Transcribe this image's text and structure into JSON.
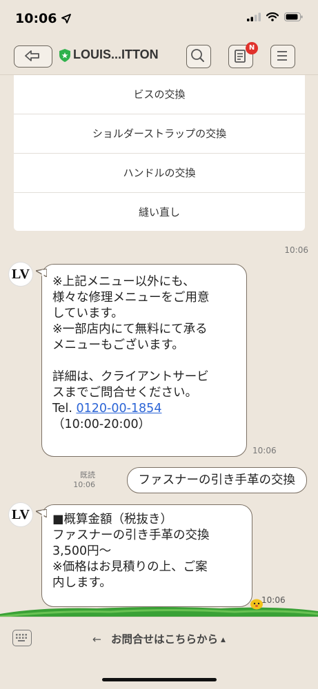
{
  "status": {
    "time": "10:06"
  },
  "nav": {
    "title": "LOUIS...ITTON",
    "badge": "N"
  },
  "menu": {
    "items": [
      "ビスの交換",
      "ショルダーストラップの交換",
      "ハンドルの交換",
      "縫い直し"
    ],
    "time": "10:06"
  },
  "avatar": {
    "text": "LV"
  },
  "messages": {
    "m1": {
      "lines": [
        "※上記メニュー以外にも、",
        "様々な修理メニューをご用意",
        "しています。",
        "※一部店内にて無料にて承る",
        "メニューもございます。",
        "",
        "詳細は、クライアントサービ",
        "スまでご問合せください。"
      ],
      "tel_prefix": "Tel. ",
      "tel": "0120-00-1854",
      "hours": "（10:00-20:00）",
      "time": "10:06"
    },
    "sent": {
      "read": "既読",
      "time": "10:06",
      "text": "ファスナーの引き手革の交換"
    },
    "m2": {
      "lines": [
        "■概算金額（税抜き）",
        "ファスナーの引き手革の交換",
        "3,500円～",
        "※価格はお見積りの上、ご案",
        "内します。"
      ],
      "time": "10:06"
    }
  },
  "bottom": {
    "richmenu_label": "お問合せはこちらから",
    "arrow_left": "←",
    "arrow_up": "▲"
  },
  "colors": {
    "background": "#ede6dc",
    "link": "#2b64d6",
    "badge": "#e0312b",
    "shield": "#2fb24c",
    "grass": "#3aa136"
  },
  "icons": [
    "location-arrow-icon",
    "signal-icon",
    "wifi-icon",
    "battery-icon",
    "back-arrow-icon",
    "shield-icon",
    "search-icon",
    "notes-icon",
    "menu-icon",
    "keyboard-icon",
    "character-icon"
  ]
}
